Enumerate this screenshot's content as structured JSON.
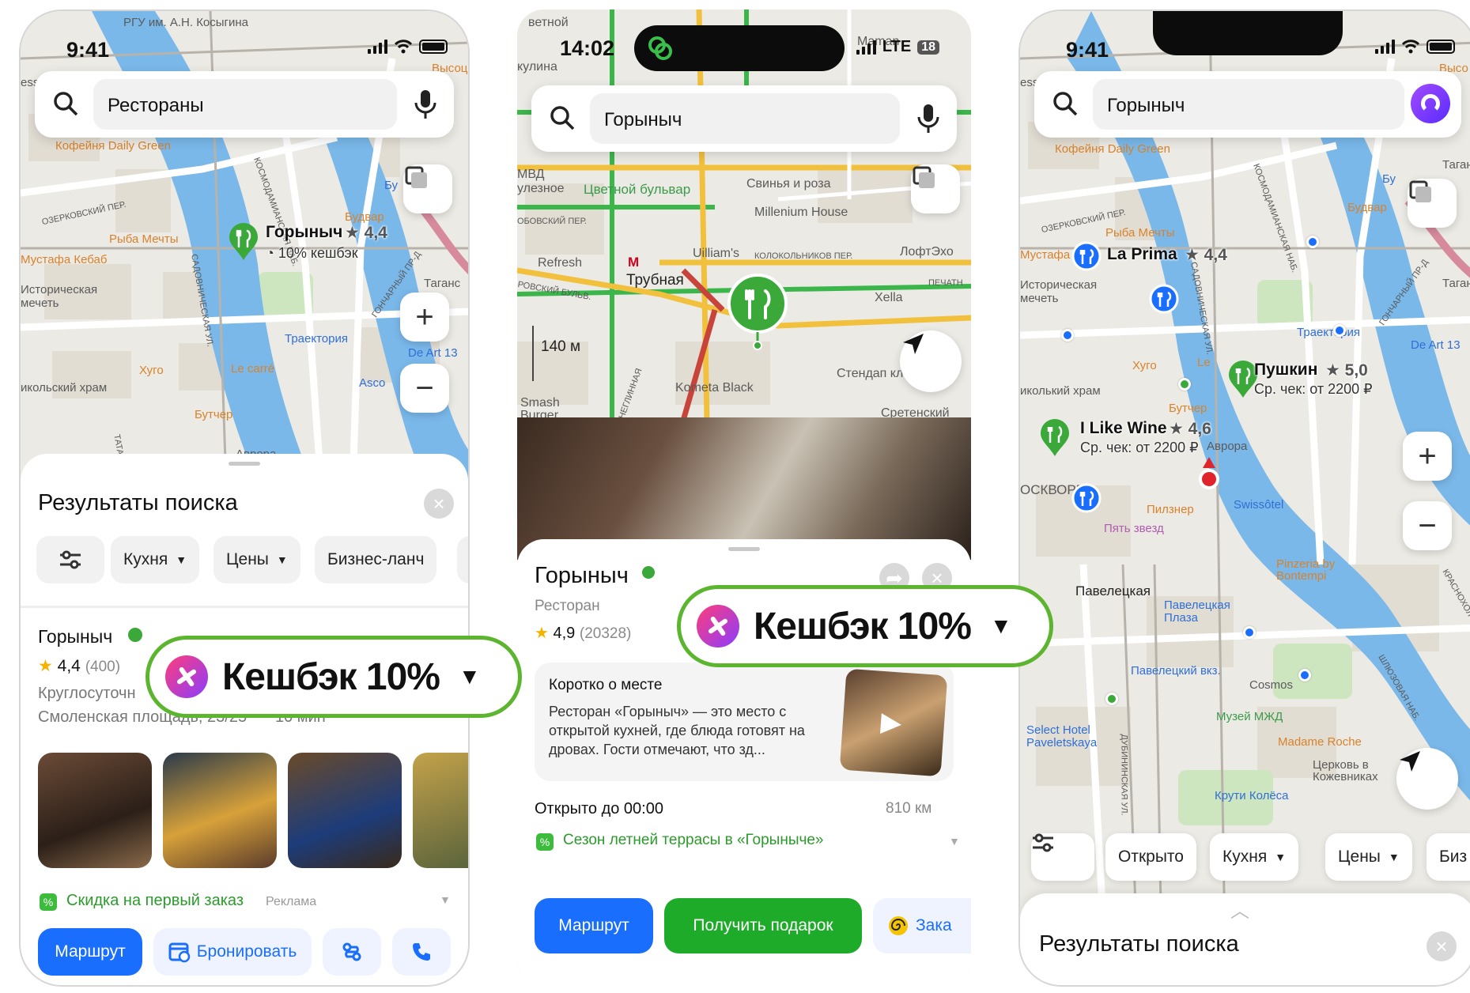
{
  "phone1": {
    "status_time": "9:41",
    "search_query": "Рестораны",
    "map": {
      "labels": [
        "РГУ им. А.Н. Косыгина",
        "Кофейня Daily Green",
        "Рыба Мечты",
        "Мустафа Кебаб",
        "Историческая мечеть",
        "Будвар",
        "Хуго",
        "Le carré",
        "Траектория",
        "Asco",
        "De Art 13",
        "Бутчер",
        "Аврора",
        "Таганс",
        "Высоц",
        "Бу",
        "икольский храм",
        "ess"
      ],
      "streets": [
        "ОЗЕРКОВСКИЙ ПЕР.",
        "КОСМОДАМИАНСКАЯ НАБ.",
        "САДОВНИЧЕСКАЯ УЛ.",
        "ГОНЧАРНЫЙ ПР-Д",
        "ТАТАРС"
      ],
      "pin_name": "Горыныч",
      "pin_rating": "★ 4,4",
      "pin_cashback": "10% кешбэк"
    },
    "sheet": {
      "title": "Результаты поиска",
      "chips": [
        {
          "label": "",
          "icon": "sliders-icon"
        },
        {
          "label": "Кухня"
        },
        {
          "label": "Цены"
        },
        {
          "label": "Бизнес-ланч"
        }
      ],
      "result": {
        "name": "Горыныч",
        "rating": "4,4",
        "reviews": "(400)",
        "hours": "Круглосуточн",
        "address": "Смоленская площадь, 23/25",
        "distance": "10 мин"
      },
      "promo": "Скидка на первый заказ",
      "promo_tag": "Реклама",
      "buttons": {
        "route": "Маршрут",
        "book": "Бронировать"
      }
    },
    "cashback_label": "Кешбэк 10%"
  },
  "phone2": {
    "status_time": "14:02",
    "status_network": "LTE",
    "status_battery": "18",
    "search_query": "Горыныч",
    "map": {
      "labels": [
        "Цветной бульвар",
        "Свинья и роза",
        "Millenium House",
        "Refresh",
        "Трубная",
        "Uilliam's",
        "ЛофтЭхо",
        "Xella",
        "Стендап кл",
        "Kometa Black",
        "Smash Burger",
        "МВД",
        "улезное",
        "кулина",
        "Сретенский",
        "Maman",
        "ветной"
      ],
      "streets": [
        "КОЛОКОЛЬНИКОВ ПЕР.",
        "РОВСКИЙ БУЛЬВ.",
        "ОБОВСКИЙ ПЕР.",
        "ПЕЧАТН",
        "НЕГЛИННАЯ"
      ],
      "scale": "140 м"
    },
    "sheet": {
      "name": "Горыныч",
      "category": "Ресторан",
      "rating": "4,9",
      "reviews": "(20328)",
      "about_title": "Коротко о месте",
      "about_text": "Ресторан «Горыныч» — это место с открытой кухней, где блюда готовят на дровах. Гости отмечают, что зд...",
      "open_until": "Открыто до 00:00",
      "distance": "810 км",
      "promo": "Сезон летней террасы в «Горыныче»",
      "buttons": {
        "route": "Маршрут",
        "gift": "Получить подарок",
        "order": "Зака"
      }
    },
    "cashback_label": "Кешбэк 10%"
  },
  "phone3": {
    "status_time": "9:41",
    "search_query": "Горыныч",
    "map": {
      "labels": [
        "Кофейня Daily Green",
        "Будвар",
        "Бу",
        "Рыба Мечты",
        "Мустафа",
        "Историческая мечеть",
        "Траектория",
        "Хуго",
        "Le",
        "De Art 13",
        "Бутчер",
        "Аврора",
        "Swissôtel",
        "Пилзнер",
        "Пять звезд",
        "Pinzeria by Bontempi",
        "Павелецкая",
        "Павелецкая Плаза",
        "Павелецкий вкз.",
        "Cosmos",
        "Музей МЖД",
        "Madame Roche",
        "Select Hotel Paveletskaya",
        "Крути Колёса",
        "Церковь в Кожевниках",
        "Таганс",
        "Таган",
        "Высо",
        "иколький храм",
        "ess",
        "ОСКВОРЕ"
      ],
      "streets": [
        "ОЗЕРКОВСКИЙ ПЕР.",
        "КОСМОДАМИАНСКАЯ НАБ.",
        "САДОВНИЧЕСКАЯ УЛ.",
        "ГОНЧАРНЫЙ ПР-Д",
        "ДУБИНИНСКАЯ УЛ.",
        "ШЛЮЗОВАЯ НАБ.",
        "КРАСНОХОЛ"
      ],
      "pins": [
        {
          "name": "La Prima",
          "rating": "★ 4,4"
        },
        {
          "name": "Пушкин",
          "rating": "★ 5,0",
          "sub": "Ср. чек: от 2200 ₽"
        },
        {
          "name": "I Like Wine",
          "rating": "★ 4,6",
          "sub": "Ср. чек: от 2200 ₽"
        }
      ]
    },
    "chips": [
      {
        "label": "",
        "icon": "sliders-icon"
      },
      {
        "label": "Открыто"
      },
      {
        "label": "Кухня"
      },
      {
        "label": "Цены"
      },
      {
        "label": "Биз"
      }
    ],
    "sheet_title": "Результаты поиска"
  },
  "colors": {
    "brand_blue": "#1a6efe",
    "brand_green": "#1fab2a",
    "cashback_border": "#5bb52e",
    "river": "#74b4ea",
    "map_bg": "#eceae4"
  }
}
